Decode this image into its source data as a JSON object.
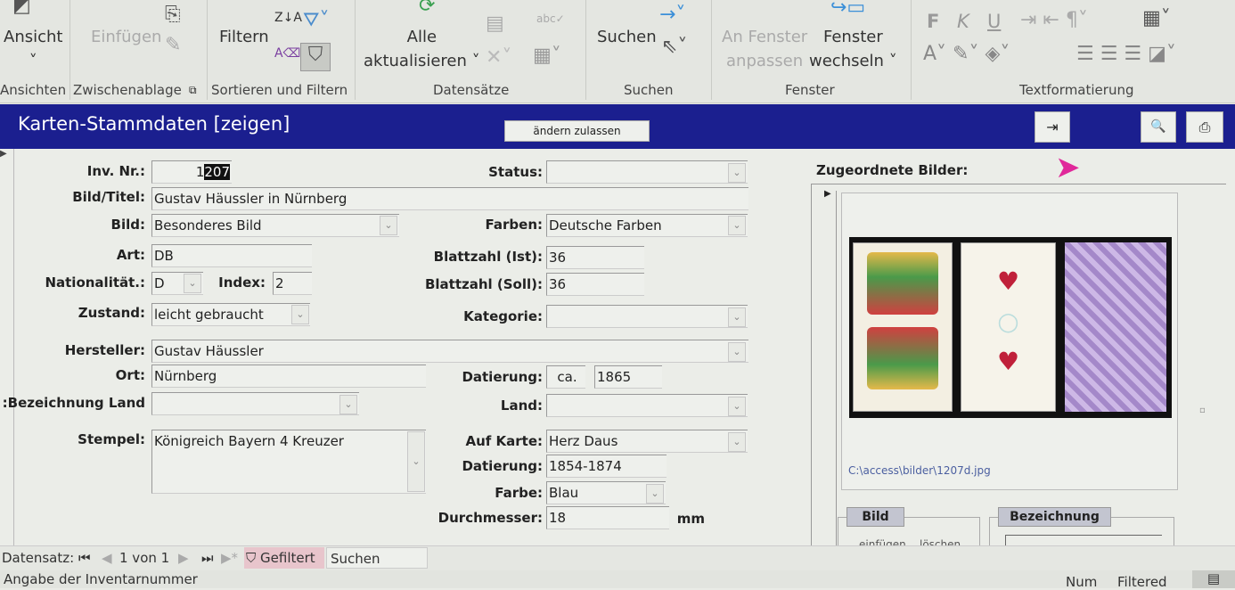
{
  "ribbon": {
    "buttons": {
      "ansicht": "Ansicht",
      "einfuegen": "Einfügen",
      "filtern": "Filtern",
      "alle": "Alle",
      "aktualisieren": "aktualisieren",
      "suchen": "Suchen",
      "an_fenster": "An Fenster",
      "anpassen": "anpassen",
      "fenster": "Fenster",
      "wechseln": "wechseln"
    },
    "groups": [
      "Ansichten",
      "Zwischenablage",
      "Sortieren und Filtern",
      "Datensätze",
      "Suchen",
      "Fenster",
      "Textformatierung"
    ],
    "format": {
      "bold": "F",
      "italic": "K",
      "underline": "U"
    }
  },
  "form": {
    "title": "Karten-Stammdaten [zeigen]",
    "edit_button": "ändern zulassen",
    "labels": {
      "inv": "Inv. Nr.:",
      "titel": "Bild/Titel:",
      "bild": "Bild:",
      "art": "Art:",
      "nat": "Nationalität.:",
      "index": "Index:",
      "zustand": "Zustand:",
      "hersteller": "Hersteller:",
      "ort": "Ort:",
      "bezland": "Bezeichnung Land:",
      "stempel": "Stempel:",
      "status": "Status:",
      "farben": "Farben:",
      "ist": "Blattzahl (Ist):",
      "soll": "Blattzahl (Soll):",
      "kategorie": "Kategorie:",
      "datierung": "Datierung:",
      "land": "Land:",
      "aufkarte": "Auf Karte:",
      "datierung2": "Datierung:",
      "farbe": "Farbe:",
      "durchmesser": "Durchmesser:",
      "mm": "mm"
    },
    "values": {
      "inv_a": "1",
      "inv_b": "207",
      "titel": "Gustav Häussler in Nürnberg",
      "bild": "Besonderes Bild",
      "art": "DB",
      "nat": "D",
      "index": "2",
      "zustand": "leicht gebraucht",
      "hersteller": "Gustav Häussler",
      "ort": "Nürnberg",
      "bezland": "",
      "stempel": "Königreich Bayern 4 Kreuzer",
      "status": "",
      "farben": "Deutsche Farben",
      "ist": "36",
      "soll": "36",
      "kategorie": "",
      "datierung_ca": "ca.",
      "datierung": "1865",
      "land": "",
      "aufkarte": "Herz Daus",
      "datierung2": "1854-1874",
      "farbe": "Blau",
      "durchmesser": "18"
    },
    "images": {
      "heading": "Zugeordnete Bilder:",
      "path": "C:\\access\\bilder\\1207d.jpg",
      "bild_group": "Bild",
      "einfuegen": "einfügen",
      "loeschen": "löschen",
      "bez_group": "Bezeichnung"
    }
  },
  "nav": {
    "label": "Datensatz:",
    "position": "1 von 1",
    "filter": "Gefiltert",
    "search": "Suchen"
  },
  "status": {
    "text": "Angabe der Inventarnummer",
    "num": "Num",
    "filtered": "Filtered"
  }
}
